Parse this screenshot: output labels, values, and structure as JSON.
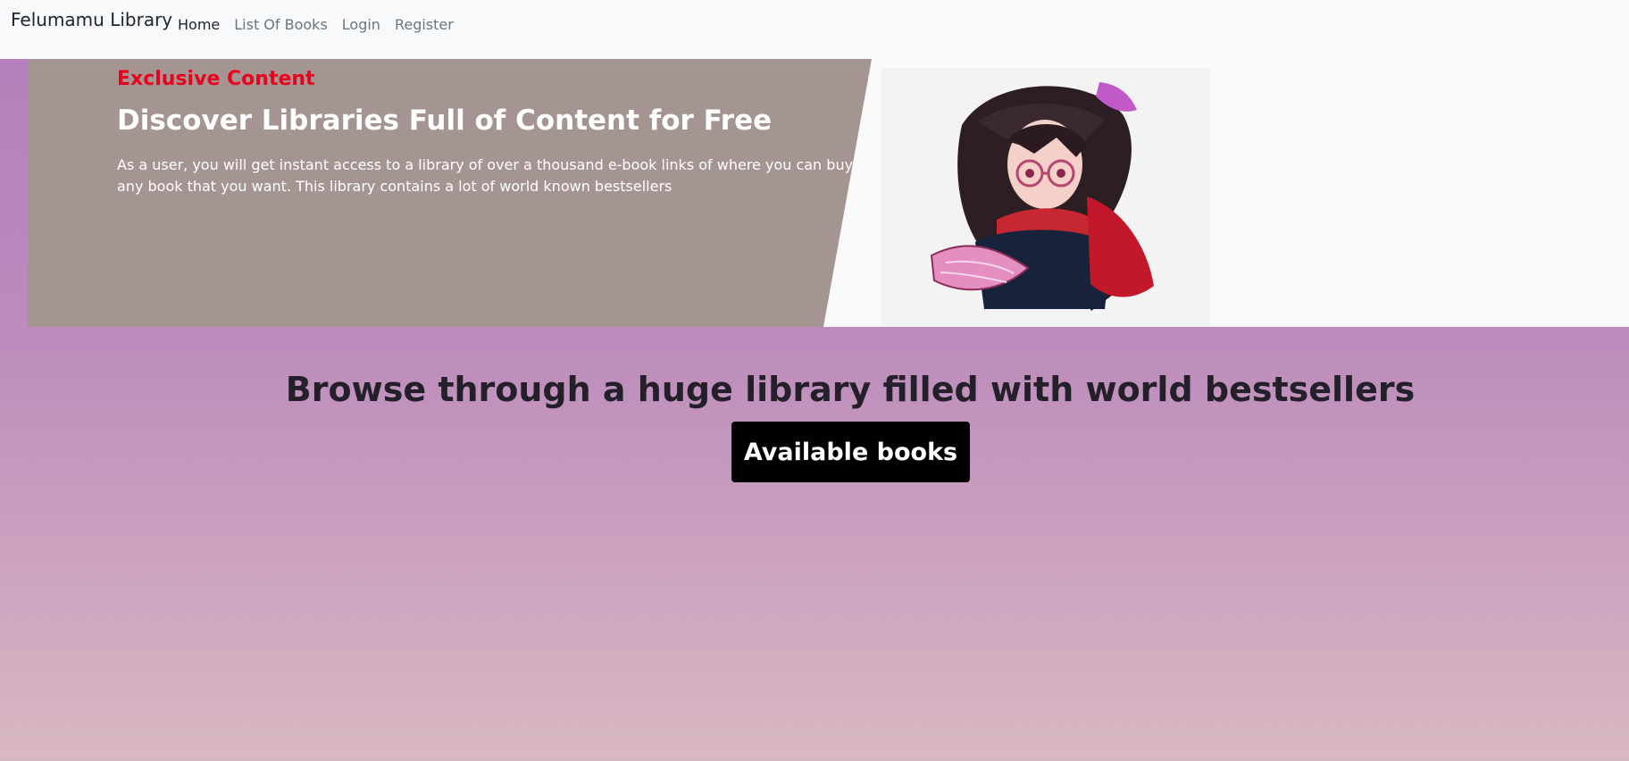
{
  "navbar": {
    "brand": "Felumamu Library",
    "links": [
      {
        "label": "Home"
      },
      {
        "label": "List Of Books"
      },
      {
        "label": "Login"
      },
      {
        "label": "Register"
      }
    ]
  },
  "hero": {
    "eyebrow": "Exclusive Content",
    "headline": "Discover Libraries Full of Content for Free",
    "lead": "As a user, you will get instant access to a library of over a thousand e-book links of where you can buy any book that you want. This library contains a lot of world known bestsellers"
  },
  "main": {
    "title": "Browse through a huge library filled with world bestsellers",
    "button_label": "Available books"
  }
}
